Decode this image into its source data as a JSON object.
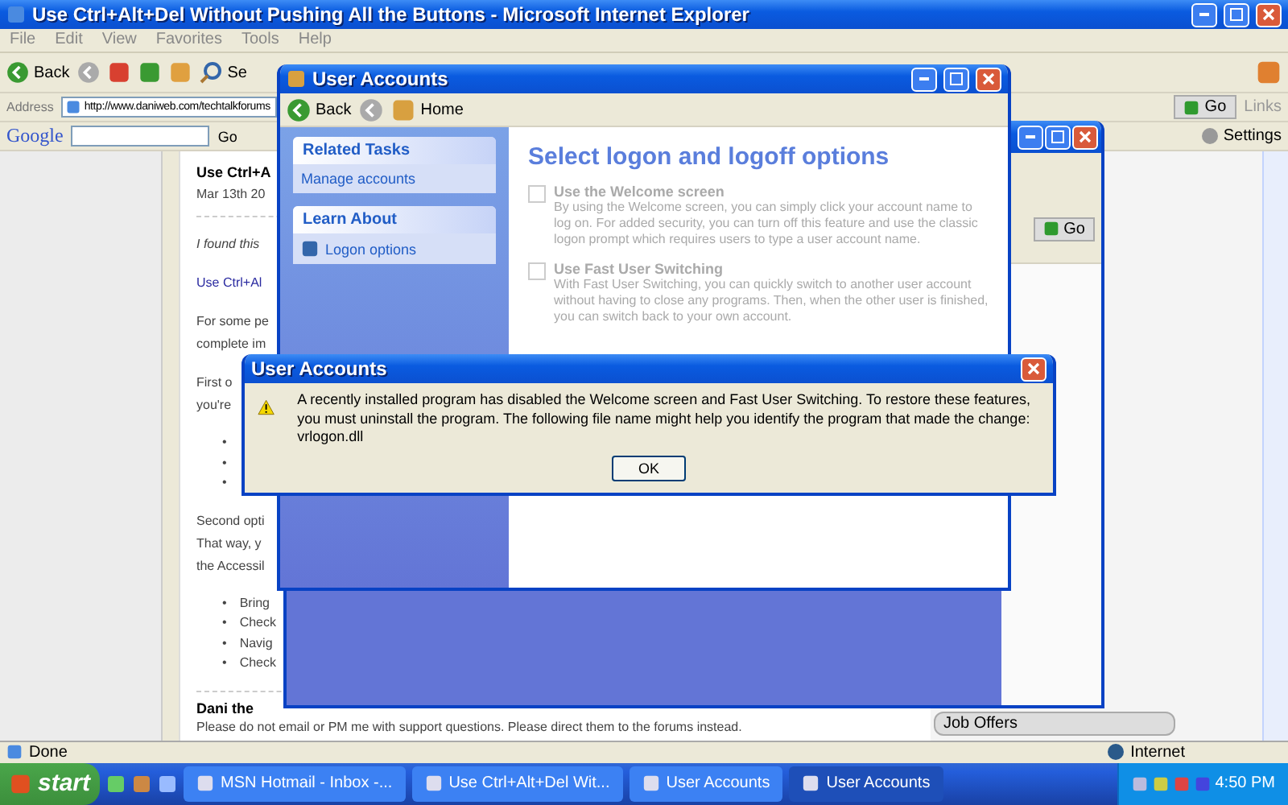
{
  "browser": {
    "title": "Use Ctrl+Alt+Del Without Pushing All the Buttons - Microsoft Internet Explorer",
    "menu": [
      "File",
      "Edit",
      "View",
      "Favorites",
      "Tools",
      "Help"
    ],
    "toolbar": {
      "back": "Back",
      "search": "Se"
    },
    "address": {
      "label": "Address",
      "value": "http://www.daniweb.com/techtalkforums",
      "go": "Go",
      "links": "Links"
    },
    "google_bar": {
      "logo": "Google",
      "go": "Go",
      "settings": "Settings"
    },
    "article": [
      {
        "kind": "heading",
        "lines": [
          "Use Ctrl+A"
        ]
      },
      {
        "kind": "meta",
        "lines": [
          "Mar 13th 20"
        ]
      },
      {
        "kind": "italic",
        "lines": [
          "I found this"
        ]
      },
      {
        "kind": "link",
        "lines": [
          "Use Ctrl+Al"
        ]
      },
      {
        "kind": "paragraph",
        "lines": [
          "For some pe",
          "complete im"
        ]
      },
      {
        "kind": "paragraph",
        "lines": [
          "First o",
          "you're"
        ]
      },
      {
        "kind": "list",
        "items": [
          {
            "bullet": "•"
          },
          {
            "bullet": "•"
          },
          {
            "bullet": "•"
          }
        ]
      },
      {
        "kind": "paragraph",
        "lines": [
          "Second opti",
          "That way, y",
          "the Accessil"
        ]
      },
      {
        "kind": "list",
        "items": [
          {
            "bullet": "•",
            "text": "Bring"
          },
          {
            "bullet": "•",
            "text": "Check"
          },
          {
            "bullet": "•",
            "text": "Navig"
          },
          {
            "bullet": "•",
            "text": "Check"
          }
        ]
      }
    ],
    "signature": {
      "name": "Dani the",
      "note": "Please do not email or PM me with support questions. Please direct them to the forums instead."
    },
    "sidebar": {
      "job_offers": "Job Offers"
    },
    "status_bar": {
      "text": "Done",
      "zone": "Internet"
    }
  },
  "back_window": {
    "go": "Go"
  },
  "user_accounts": {
    "title": "User Accounts",
    "back": "Back",
    "home": "Home",
    "panels": [
      {
        "title": "Related Tasks",
        "items": [
          {
            "label": "Manage accounts",
            "icon": false
          }
        ]
      },
      {
        "title": "Learn About",
        "items": [
          {
            "label": "Logon options",
            "icon": true
          }
        ]
      }
    ],
    "heading": "Select logon and logoff options",
    "options": [
      {
        "label": "Use the Welcome screen",
        "description": "By using the Welcome screen, you can simply click your account name to log on. For added security, you can turn off this feature and use the classic logon prompt which requires users to type a user account name.",
        "checked": false,
        "disabled": true
      },
      {
        "label": "Use Fast User Switching",
        "description": "With Fast User Switching, you can quickly switch to another user account without having to close any programs. Then, when the other user is finished, you can switch back to your own account.",
        "checked": false,
        "disabled": true
      }
    ]
  },
  "dialog": {
    "title": "User Accounts",
    "message": "A recently installed program has disabled the Welcome screen and Fast User Switching. To restore these features, you must uninstall the program. The following file name might help you identify the program that made the change:  vrlogon.dll",
    "button": "OK"
  },
  "taskbar": {
    "start": "start",
    "tasks": [
      {
        "label": "MSN Hotmail - Inbox -...",
        "selected": false
      },
      {
        "label": "Use Ctrl+Alt+Del Wit...",
        "selected": false
      },
      {
        "label": "User Accounts",
        "selected": false
      },
      {
        "label": "User Accounts",
        "selected": true
      }
    ],
    "clock": "4:50 PM"
  }
}
